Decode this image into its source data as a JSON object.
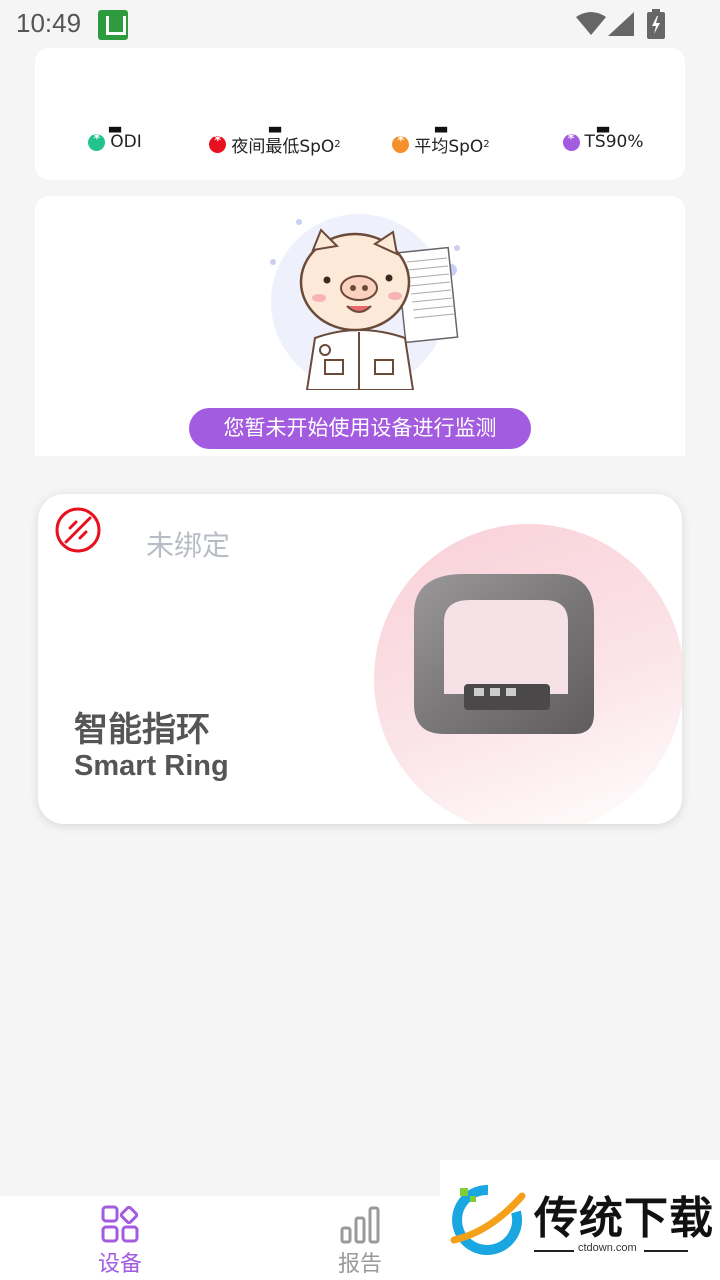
{
  "status_bar": {
    "time": "10:49",
    "app_icon": "u-app-icon",
    "icons": [
      "wifi-icon",
      "signal-icon",
      "battery-charging-icon"
    ]
  },
  "metrics": [
    {
      "value": "-",
      "label": "ODI",
      "sub": "",
      "dot_color": "#22c38e"
    },
    {
      "value": "-",
      "label": "夜间最低SpO",
      "sub": "2",
      "dot_color": "#e8101e"
    },
    {
      "value": "-",
      "label": "平均SpO",
      "sub": "2",
      "dot_color": "#f5902a"
    },
    {
      "value": "-",
      "label": "TS90%",
      "sub": "",
      "dot_color": "#a35be0"
    }
  ],
  "empty_state": {
    "illustration": "pig-doctor-illustration",
    "message": "您暂未开始使用设备进行监测"
  },
  "device_card": {
    "status_icon": "unbound-icon",
    "status_text": "未绑定",
    "name_cn": "智能指环",
    "name_en": "Smart Ring",
    "image": "smart-ring-image"
  },
  "bottom_nav": {
    "items": [
      {
        "label": "设备",
        "icon": "grid-icon",
        "active": true
      },
      {
        "label": "报告",
        "icon": "bar-chart-icon",
        "active": false
      }
    ],
    "active_color": "#a35be0",
    "inactive_color": "#9a9a9a"
  },
  "watermark": {
    "title": "传统下载",
    "url": "ctdown.com"
  }
}
